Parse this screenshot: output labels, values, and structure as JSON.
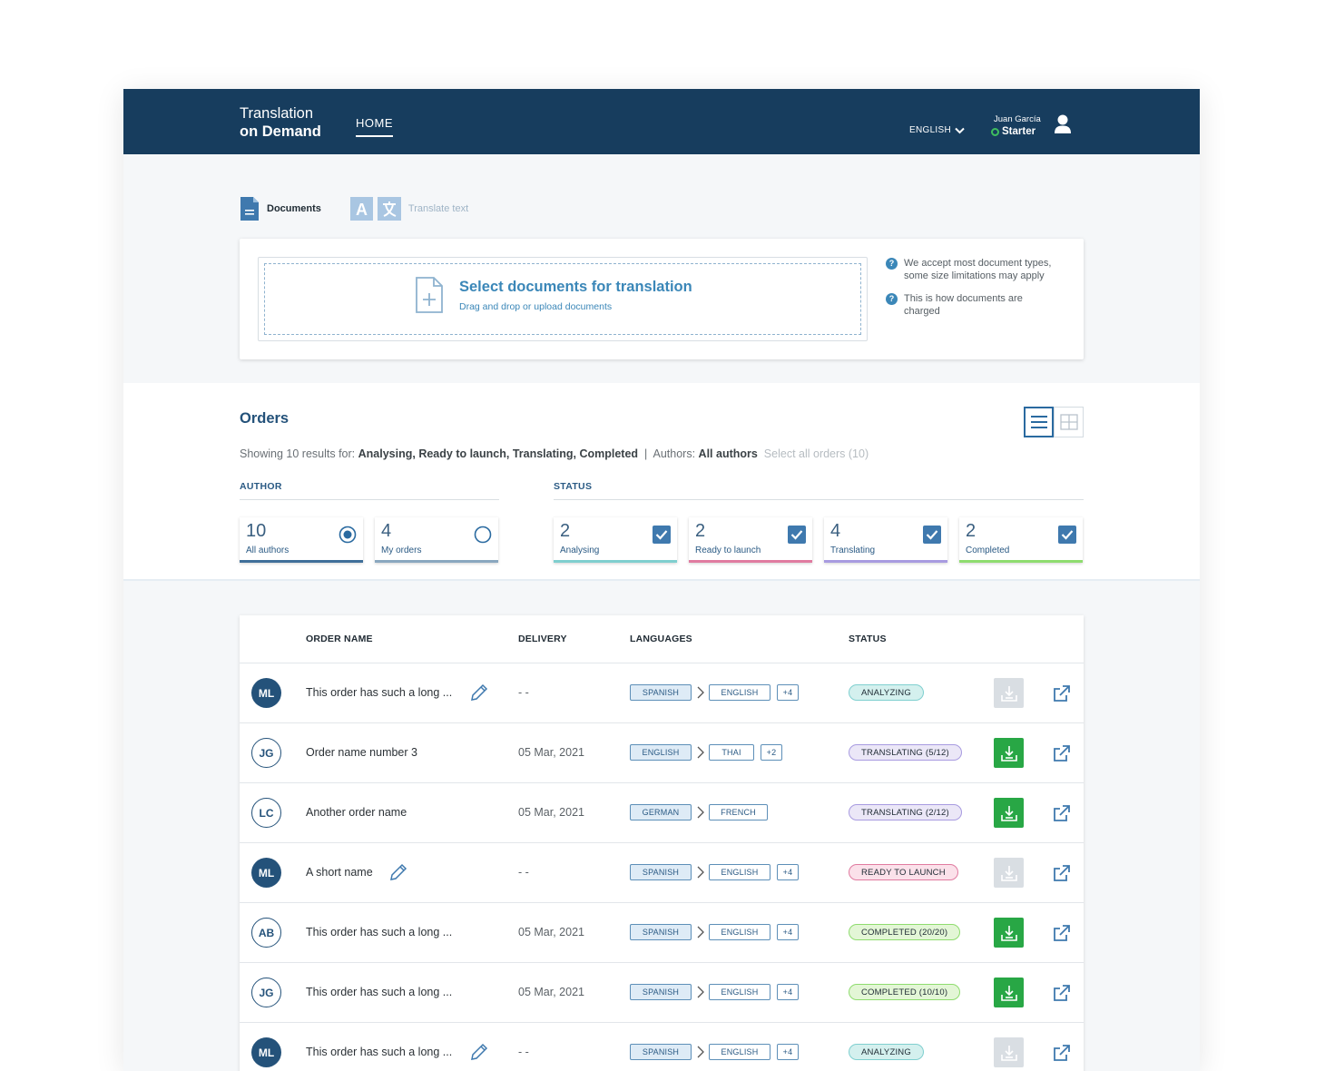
{
  "header": {
    "brand_line1": "Translation",
    "brand_line2": "on Demand",
    "nav_home": "HOME",
    "language": "ENGLISH",
    "user_name": "Juan García",
    "user_plan": "Starter",
    "bg_color": "#173d5e"
  },
  "mode_tabs": {
    "documents": "Documents",
    "translate_text": "Translate text"
  },
  "upload": {
    "title": "Select documents for translation",
    "subtitle": "Drag and drop or upload documents",
    "help1": "We accept most document types, some size limitations may apply",
    "help2": "This is how documents are charged"
  },
  "orders": {
    "title": "Orders",
    "showing_prefix": "Showing 10 results for:",
    "showing_filters": "Analysing, Ready to launch, Translating, Completed",
    "showing_sep": "|",
    "authors_label": "Authors:",
    "authors_value": "All authors",
    "select_all": "Select all orders (10)",
    "author_group_label": "AUTHOR",
    "status_group_label": "STATUS",
    "author_filters": [
      {
        "count": "10",
        "label": "All authors",
        "selected": true
      },
      {
        "count": "4",
        "label": "My orders",
        "selected": false
      }
    ],
    "status_filters": [
      {
        "count": "2",
        "label": "Analysing",
        "checked": true,
        "color": "#7fcfcf"
      },
      {
        "count": "2",
        "label": "Ready to launch",
        "checked": true,
        "color": "#e07ba0"
      },
      {
        "count": "4",
        "label": "Translating",
        "checked": true,
        "color": "#a89be0"
      },
      {
        "count": "2",
        "label": "Completed",
        "checked": true,
        "color": "#8fdc6f"
      }
    ]
  },
  "table": {
    "columns": [
      "ORDER NAME",
      "DELIVERY",
      "LANGUAGES",
      "STATUS"
    ],
    "rows": [
      {
        "initials": "ML",
        "avatar": "filled",
        "name": "This order has such a long ...",
        "editable": true,
        "delivery": "- -",
        "src": "SPANISH",
        "tgt": "ENGLISH",
        "more": "+4",
        "status": "ANALYZING",
        "status_bg": "#d4f0ee",
        "status_border": "#7fcfcf",
        "download": false
      },
      {
        "initials": "JG",
        "avatar": "outline",
        "name": "Order name number 3",
        "editable": false,
        "delivery": "05 Mar, 2021",
        "src": "ENGLISH",
        "tgt": "THAI",
        "more": "+2",
        "status": "TRANSLATING (5/12)",
        "status_bg": "#ebe7f7",
        "status_border": "#a89be0",
        "download": true
      },
      {
        "initials": "LC",
        "avatar": "outline",
        "name": "Another order name",
        "editable": false,
        "delivery": "05 Mar, 2021",
        "src": "GERMAN",
        "tgt": "FRENCH",
        "more": "",
        "status": "TRANSLATING (2/12)",
        "status_bg": "#ebe7f7",
        "status_border": "#a89be0",
        "download": true
      },
      {
        "initials": "ML",
        "avatar": "filled",
        "name": "A short name",
        "editable": true,
        "delivery": "- -",
        "src": "SPANISH",
        "tgt": "ENGLISH",
        "more": "+4",
        "status": "READY TO LAUNCH",
        "status_bg": "#fbe1ea",
        "status_border": "#e07ba0",
        "download": false
      },
      {
        "initials": "AB",
        "avatar": "outline",
        "name": "This order has such a long ...",
        "editable": false,
        "delivery": "05 Mar, 2021",
        "src": "SPANISH",
        "tgt": "ENGLISH",
        "more": "+4",
        "status": "COMPLETED (20/20)",
        "status_bg": "#e3f6d6",
        "status_border": "#8fdc6f",
        "download": true
      },
      {
        "initials": "JG",
        "avatar": "outline",
        "name": "This order has such a long ...",
        "editable": false,
        "delivery": "05 Mar, 2021",
        "src": "SPANISH",
        "tgt": "ENGLISH",
        "more": "+4",
        "status": "COMPLETED (10/10)",
        "status_bg": "#e3f6d6",
        "status_border": "#8fdc6f",
        "download": true
      },
      {
        "initials": "ML",
        "avatar": "filled",
        "name": "This order has such a long ...",
        "editable": true,
        "delivery": "- -",
        "src": "SPANISH",
        "tgt": "ENGLISH",
        "more": "+4",
        "status": "ANALYZING",
        "status_bg": "#d4f0ee",
        "status_border": "#7fcfcf",
        "download": false
      }
    ]
  }
}
